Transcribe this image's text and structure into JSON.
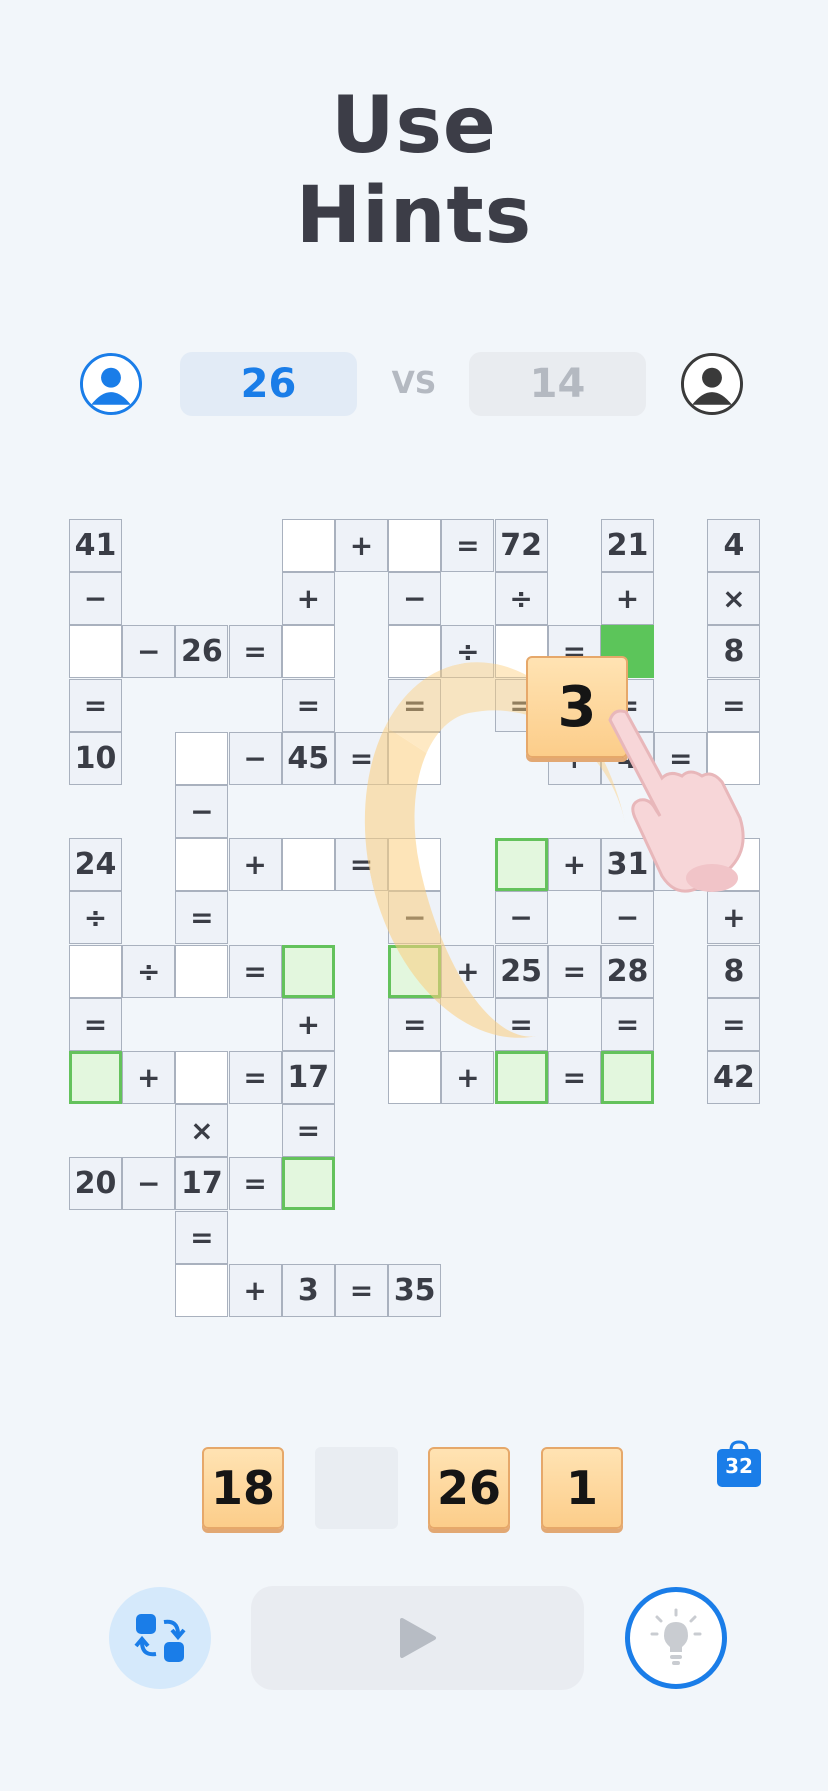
{
  "header": {
    "title_line1": "Use",
    "title_line2": "Hints"
  },
  "match": {
    "player_score": "26",
    "vs_label": "VS",
    "opponent_score": "14",
    "player_color": "#1a7de8",
    "opponent_color": "#3a3a3a"
  },
  "board": {
    "cells": [
      {
        "col": 0,
        "row": 0,
        "text": "41",
        "kind": "given"
      },
      {
        "col": 4,
        "row": 0,
        "text": "",
        "kind": "empty"
      },
      {
        "col": 5,
        "row": 0,
        "text": "+",
        "kind": "op"
      },
      {
        "col": 6,
        "row": 0,
        "text": "",
        "kind": "empty"
      },
      {
        "col": 7,
        "row": 0,
        "text": "=",
        "kind": "op"
      },
      {
        "col": 8,
        "row": 0,
        "text": "72",
        "kind": "given"
      },
      {
        "col": 10,
        "row": 0,
        "text": "21",
        "kind": "given"
      },
      {
        "col": 12,
        "row": 0,
        "text": "4",
        "kind": "given"
      },
      {
        "col": 0,
        "row": 1,
        "text": "−",
        "kind": "op"
      },
      {
        "col": 4,
        "row": 1,
        "text": "+",
        "kind": "op"
      },
      {
        "col": 6,
        "row": 1,
        "text": "−",
        "kind": "op"
      },
      {
        "col": 8,
        "row": 1,
        "text": "÷",
        "kind": "op"
      },
      {
        "col": 10,
        "row": 1,
        "text": "+",
        "kind": "op"
      },
      {
        "col": 12,
        "row": 1,
        "text": "×",
        "kind": "op"
      },
      {
        "col": 0,
        "row": 2,
        "text": "",
        "kind": "empty"
      },
      {
        "col": 1,
        "row": 2,
        "text": "−",
        "kind": "op"
      },
      {
        "col": 2,
        "row": 2,
        "text": "26",
        "kind": "given"
      },
      {
        "col": 3,
        "row": 2,
        "text": "=",
        "kind": "op"
      },
      {
        "col": 4,
        "row": 2,
        "text": "",
        "kind": "empty"
      },
      {
        "col": 6,
        "row": 2,
        "text": "",
        "kind": "empty"
      },
      {
        "col": 7,
        "row": 2,
        "text": "÷",
        "kind": "op"
      },
      {
        "col": 8,
        "row": 2,
        "text": "",
        "kind": "empty"
      },
      {
        "col": 9,
        "row": 2,
        "text": "=",
        "kind": "op"
      },
      {
        "col": 10,
        "row": 2,
        "text": "",
        "kind": "solid"
      },
      {
        "col": 12,
        "row": 2,
        "text": "8",
        "kind": "given"
      },
      {
        "col": 0,
        "row": 3,
        "text": "=",
        "kind": "op"
      },
      {
        "col": 4,
        "row": 3,
        "text": "=",
        "kind": "op"
      },
      {
        "col": 6,
        "row": 3,
        "text": "=",
        "kind": "op"
      },
      {
        "col": 8,
        "row": 3,
        "text": "=",
        "kind": "op"
      },
      {
        "col": 10,
        "row": 3,
        "text": "=",
        "kind": "op"
      },
      {
        "col": 12,
        "row": 3,
        "text": "=",
        "kind": "op"
      },
      {
        "col": 0,
        "row": 4,
        "text": "10",
        "kind": "given"
      },
      {
        "col": 2,
        "row": 4,
        "text": "",
        "kind": "empty"
      },
      {
        "col": 3,
        "row": 4,
        "text": "−",
        "kind": "op"
      },
      {
        "col": 4,
        "row": 4,
        "text": "45",
        "kind": "given"
      },
      {
        "col": 5,
        "row": 4,
        "text": "=",
        "kind": "op"
      },
      {
        "col": 6,
        "row": 4,
        "text": "",
        "kind": "empty"
      },
      {
        "col": 9,
        "row": 4,
        "text": "+",
        "kind": "op"
      },
      {
        "col": 10,
        "row": 4,
        "text": "4",
        "kind": "given"
      },
      {
        "col": 11,
        "row": 4,
        "text": "=",
        "kind": "op"
      },
      {
        "col": 12,
        "row": 4,
        "text": "",
        "kind": "empty"
      },
      {
        "col": 2,
        "row": 5,
        "text": "−",
        "kind": "op"
      },
      {
        "col": 0,
        "row": 6,
        "text": "24",
        "kind": "given"
      },
      {
        "col": 2,
        "row": 6,
        "text": "",
        "kind": "empty"
      },
      {
        "col": 3,
        "row": 6,
        "text": "+",
        "kind": "op"
      },
      {
        "col": 4,
        "row": 6,
        "text": "",
        "kind": "empty"
      },
      {
        "col": 5,
        "row": 6,
        "text": "=",
        "kind": "op"
      },
      {
        "col": 6,
        "row": 6,
        "text": "",
        "kind": "empty"
      },
      {
        "col": 8,
        "row": 6,
        "text": "",
        "kind": "hl"
      },
      {
        "col": 9,
        "row": 6,
        "text": "+",
        "kind": "op"
      },
      {
        "col": 10,
        "row": 6,
        "text": "31",
        "kind": "given"
      },
      {
        "col": 11,
        "row": 6,
        "text": "=",
        "kind": "op"
      },
      {
        "col": 12,
        "row": 6,
        "text": "",
        "kind": "empty"
      },
      {
        "col": 0,
        "row": 7,
        "text": "÷",
        "kind": "op"
      },
      {
        "col": 2,
        "row": 7,
        "text": "=",
        "kind": "op"
      },
      {
        "col": 6,
        "row": 7,
        "text": "−",
        "kind": "op"
      },
      {
        "col": 8,
        "row": 7,
        "text": "−",
        "kind": "op"
      },
      {
        "col": 10,
        "row": 7,
        "text": "−",
        "kind": "op"
      },
      {
        "col": 12,
        "row": 7,
        "text": "+",
        "kind": "op"
      },
      {
        "col": 0,
        "row": 8,
        "text": "",
        "kind": "empty"
      },
      {
        "col": 1,
        "row": 8,
        "text": "÷",
        "kind": "op"
      },
      {
        "col": 2,
        "row": 8,
        "text": "",
        "kind": "empty"
      },
      {
        "col": 3,
        "row": 8,
        "text": "=",
        "kind": "op"
      },
      {
        "col": 4,
        "row": 8,
        "text": "",
        "kind": "hl"
      },
      {
        "col": 6,
        "row": 8,
        "text": "",
        "kind": "hl"
      },
      {
        "col": 7,
        "row": 8,
        "text": "+",
        "kind": "op"
      },
      {
        "col": 8,
        "row": 8,
        "text": "25",
        "kind": "given"
      },
      {
        "col": 9,
        "row": 8,
        "text": "=",
        "kind": "op"
      },
      {
        "col": 10,
        "row": 8,
        "text": "28",
        "kind": "given"
      },
      {
        "col": 12,
        "row": 8,
        "text": "8",
        "kind": "given"
      },
      {
        "col": 0,
        "row": 9,
        "text": "=",
        "kind": "op"
      },
      {
        "col": 4,
        "row": 9,
        "text": "+",
        "kind": "op"
      },
      {
        "col": 6,
        "row": 9,
        "text": "=",
        "kind": "op"
      },
      {
        "col": 8,
        "row": 9,
        "text": "=",
        "kind": "op"
      },
      {
        "col": 10,
        "row": 9,
        "text": "=",
        "kind": "op"
      },
      {
        "col": 12,
        "row": 9,
        "text": "=",
        "kind": "op"
      },
      {
        "col": 0,
        "row": 10,
        "text": "",
        "kind": "hl"
      },
      {
        "col": 1,
        "row": 10,
        "text": "+",
        "kind": "op"
      },
      {
        "col": 2,
        "row": 10,
        "text": "",
        "kind": "empty"
      },
      {
        "col": 3,
        "row": 10,
        "text": "=",
        "kind": "op"
      },
      {
        "col": 4,
        "row": 10,
        "text": "17",
        "kind": "given"
      },
      {
        "col": 6,
        "row": 10,
        "text": "",
        "kind": "empty"
      },
      {
        "col": 7,
        "row": 10,
        "text": "+",
        "kind": "op"
      },
      {
        "col": 8,
        "row": 10,
        "text": "",
        "kind": "hl"
      },
      {
        "col": 9,
        "row": 10,
        "text": "=",
        "kind": "op"
      },
      {
        "col": 10,
        "row": 10,
        "text": "",
        "kind": "hl"
      },
      {
        "col": 12,
        "row": 10,
        "text": "42",
        "kind": "given"
      },
      {
        "col": 2,
        "row": 11,
        "text": "×",
        "kind": "op"
      },
      {
        "col": 4,
        "row": 11,
        "text": "=",
        "kind": "op"
      },
      {
        "col": 0,
        "row": 12,
        "text": "20",
        "kind": "given"
      },
      {
        "col": 1,
        "row": 12,
        "text": "−",
        "kind": "op"
      },
      {
        "col": 2,
        "row": 12,
        "text": "17",
        "kind": "given"
      },
      {
        "col": 3,
        "row": 12,
        "text": "=",
        "kind": "op"
      },
      {
        "col": 4,
        "row": 12,
        "text": "",
        "kind": "hl"
      },
      {
        "col": 2,
        "row": 13,
        "text": "=",
        "kind": "op"
      },
      {
        "col": 2,
        "row": 14,
        "text": "",
        "kind": "empty"
      },
      {
        "col": 3,
        "row": 14,
        "text": "+",
        "kind": "op"
      },
      {
        "col": 4,
        "row": 14,
        "text": "3",
        "kind": "given"
      },
      {
        "col": 5,
        "row": 14,
        "text": "=",
        "kind": "op"
      },
      {
        "col": 6,
        "row": 14,
        "text": "35",
        "kind": "given"
      }
    ]
  },
  "drag_tile": {
    "value": "3"
  },
  "tray": {
    "tiles": [
      "18",
      "",
      "26",
      "1"
    ],
    "shop_count": "32"
  },
  "controls": {
    "shuffle_icon": "shuffle-icon",
    "play_icon": "play-icon",
    "hint_icon": "lightbulb-icon"
  }
}
